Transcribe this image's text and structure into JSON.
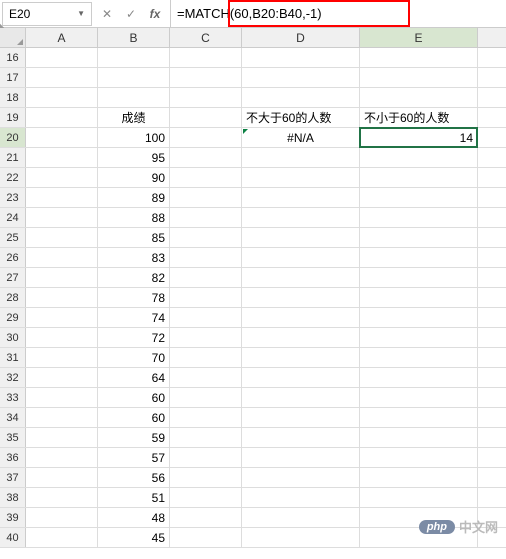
{
  "formula_bar": {
    "name_box": "E20",
    "formula": "=MATCH(60,B20:B40,-1)",
    "cancel": "✕",
    "confirm": "✓",
    "fx": "fx"
  },
  "columns": [
    "A",
    "B",
    "C",
    "D",
    "E"
  ],
  "rows_start": 16,
  "rows_end": 40,
  "headers": {
    "b19": "成绩",
    "d19": "不大于60的人数",
    "e19": "不小于60的人数"
  },
  "results": {
    "d20": "#N/A",
    "e20": "14"
  },
  "scores": [
    100,
    95,
    90,
    89,
    88,
    85,
    83,
    82,
    78,
    74,
    72,
    70,
    64,
    60,
    60,
    59,
    57,
    56,
    51,
    48,
    45
  ],
  "watermark": {
    "badge": "php",
    "text": "中文网"
  },
  "active_cell": "E20",
  "active_col": "E",
  "active_row": 20
}
